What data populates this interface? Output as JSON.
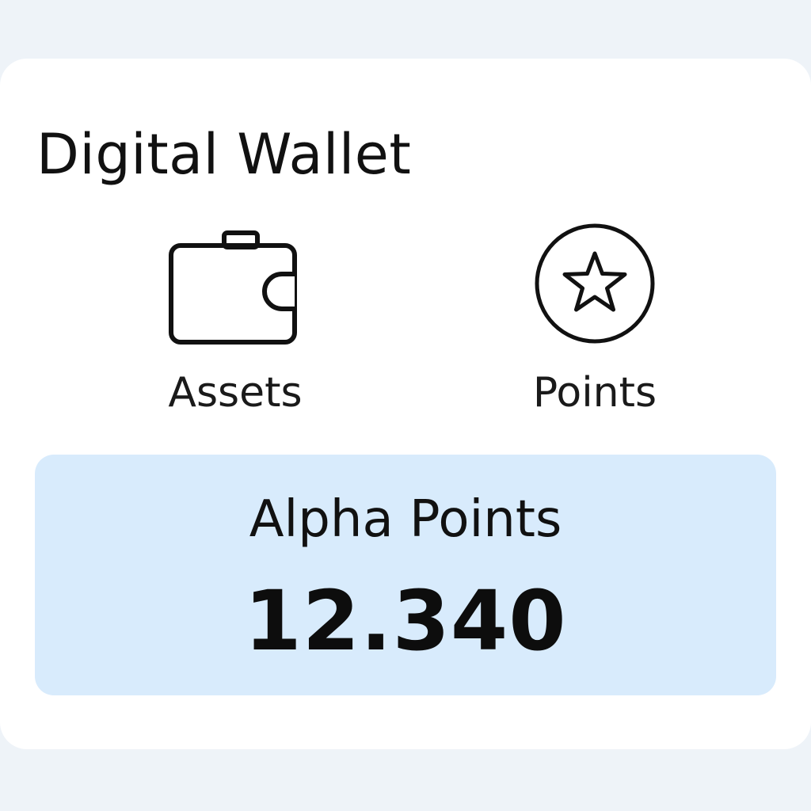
{
  "wallet": {
    "title": "Digital Wallet",
    "actions": [
      {
        "label": "Assets",
        "icon": "wallet-icon"
      },
      {
        "label": "Points",
        "icon": "star-circle-icon"
      }
    ],
    "balance": {
      "label": "Alpha Points",
      "value": "12.340"
    }
  },
  "colors": {
    "background": "#eef3f8",
    "card": "#ffffff",
    "balance_panel": "#d8ebfc",
    "text": "#111111"
  }
}
